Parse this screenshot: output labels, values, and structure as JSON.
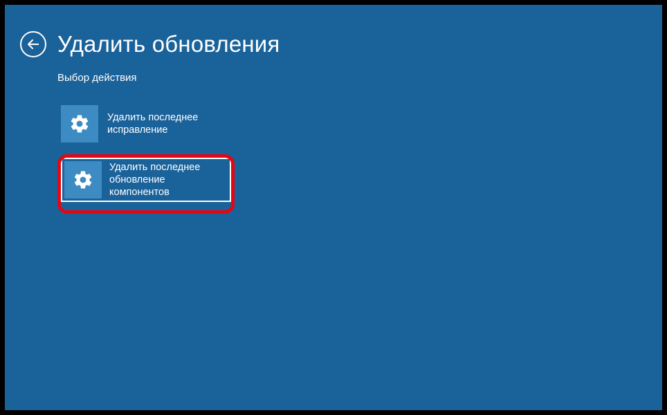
{
  "header": {
    "title": "Удалить обновления",
    "subtitle": "Выбор действия"
  },
  "options": [
    {
      "label": "Удалить последнее исправление"
    },
    {
      "label": "Удалить последнее обновление компонентов"
    }
  ]
}
